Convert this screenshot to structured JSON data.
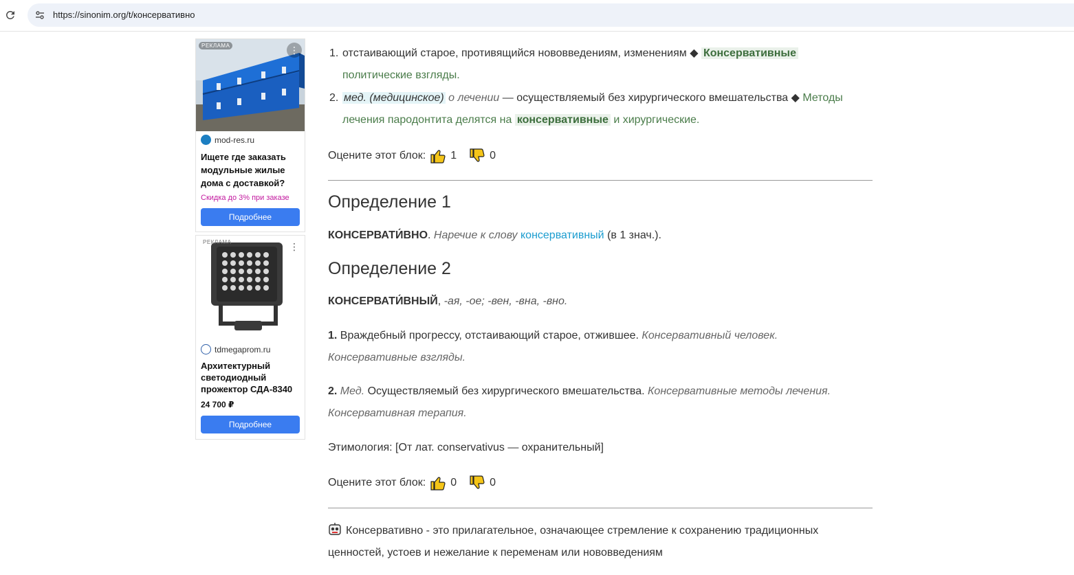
{
  "browser": {
    "url": "https://sinonim.org/t/консервативно"
  },
  "ads": [
    {
      "badge": "РЕКЛАМА",
      "domain": "mod-res.ru",
      "title": "Ищете где заказать модульные жилые дома с доставкой?",
      "subtitle": "Скидка до 3% при заказе",
      "button": "Подробнее"
    },
    {
      "badge": "РЕКЛАМА",
      "domain": "tdmegaprom.ru",
      "title": "Архитектурный светодиодный прожектор СДА-8340",
      "price": "24 700 ₽",
      "button": "Подробнее"
    }
  ],
  "meanings": [
    {
      "num": "1.",
      "text": "отстаивающий старое, противящийся нововведениям, изменениям ◆",
      "example_bold": "Консервативные",
      "example_rest": "политические взгляды."
    },
    {
      "num": "2.",
      "label": "мед. (медицинское)",
      "context": "о лечении",
      "text": "— осуществляемый без хирургического вмешательства ◆",
      "example_start": "Методы",
      "example_mid": "лечения пародонтита делятся на",
      "example_bold": "консервативные",
      "example_end": "и хирургические."
    }
  ],
  "rating1": {
    "label": "Оцените этот блок:",
    "up": "1",
    "down": "0"
  },
  "def1": {
    "heading": "Определение 1",
    "word": "КОНСЕРВАТИ́ВНО",
    "desc": "Наречие к слову",
    "link": "консервативный",
    "tail": "(в 1 знач.)."
  },
  "def2": {
    "heading": "Определение 2",
    "word": "КОНСЕРВАТИ́ВНЫЙ",
    "forms": "-ая, -ое; -вен, -вна, -вно.",
    "m1_num": "1.",
    "m1_text": "Враждебный прогрессу, отстаивающий старое, отжившее.",
    "m1_ex1": "Консервативный человек.",
    "m1_ex2": "Консервативные взгляды.",
    "m2_num": "2.",
    "m2_label": "Мед.",
    "m2_text": "Осуществляемый без хирургического вмешательства.",
    "m2_ex1": "Консервативные методы лечения.",
    "m2_ex2": "Консервативная терапия.",
    "etymology": "Этимология: [От лат. conservativus — охранительный]"
  },
  "rating2": {
    "label": "Оцените этот блок:",
    "up": "0",
    "down": "0"
  },
  "ai_summary": {
    "line1": "Консервативно - это прилагательное, означающее стремление к сохранению традиционных",
    "line2": "ценностей, устоев и нежелание к переменам или нововведениям"
  },
  "colors": {
    "accent_green": "#4a7c4a",
    "link_blue": "#1a9ccf",
    "ad_button": "#3a7cf0",
    "ad_promo": "#c2189e",
    "thumb_yellow": "#f5c518"
  }
}
